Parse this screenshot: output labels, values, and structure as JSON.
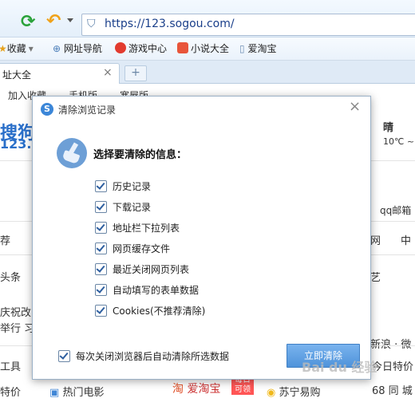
{
  "browser": {
    "url": "https://123.sogou.com/",
    "bookmarks": [
      "收藏",
      "网址导航",
      "游戏中心",
      "小说大全",
      "爱淘宝"
    ],
    "tab_title": "址大全"
  },
  "page": {
    "subnav": [
      "加入收藏",
      "手机版",
      "寒屋版"
    ],
    "logo": "搜狗网",
    "logo_sub": "123.so",
    "weather_day": "晴",
    "weather_temp": "10℃ ~",
    "email": "qq邮箱",
    "left_items": [
      "荐",
      "头条",
      "庆祝改",
      "举行 习",
      "工具",
      "特价"
    ],
    "right_items": [
      "网",
      "中",
      "艺",
      "新浪 · 微",
      "今日特价",
      "68 同 城"
    ],
    "bottom": [
      "热门电影",
      "爱淘宝",
      "每日可领",
      "苏宁易购"
    ]
  },
  "dialog": {
    "title": "清除浏览记录",
    "heading": "选择要清除的信息：",
    "options": [
      "历史记录",
      "下载记录",
      "地址栏下拉列表",
      "网页缓存文件",
      "最近关闭网页列表",
      "自动填写的表单数据",
      "Cookies(不推荐清除)"
    ],
    "auto_clear": "每次关闭浏览器后自动清除所选数据",
    "clear_button": "立即清除"
  },
  "watermark": "Bai du 经验"
}
